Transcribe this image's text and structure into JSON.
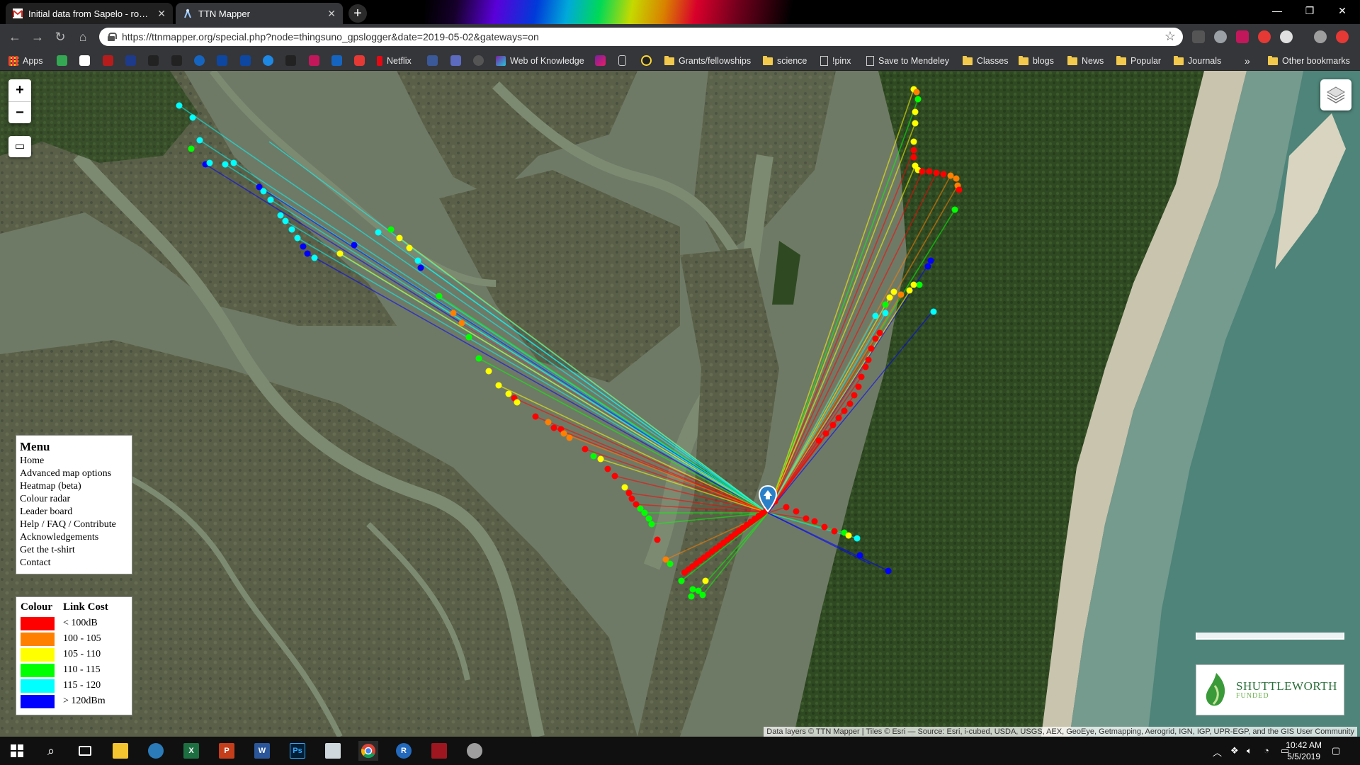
{
  "browser": {
    "tabs": [
      {
        "title": "Initial data from Sapelo - robert",
        "active": false
      },
      {
        "title": "TTN Mapper",
        "active": true
      }
    ],
    "url": "https://ttnmapper.org/special.php?node=thingsuno_gpslogger&date=2019-05-02&gateways=on",
    "bookmarks": [
      "Apps",
      "Netflix",
      "Web of Knowledge",
      "Grants/fellowships",
      "science",
      "!pinx",
      "Save to Mendeley",
      "Classes",
      "blogs",
      "News",
      "Popular",
      "Journals"
    ],
    "other_bookmarks": "Other bookmarks",
    "overflow": "»"
  },
  "map": {
    "zoom_in": "+",
    "zoom_out": "−",
    "menu": {
      "title": "Menu",
      "items": [
        "Home",
        "Advanced map options",
        "Heatmap (beta)",
        "Colour radar",
        "Leader board",
        "Help / FAQ / Contribute",
        "Acknowledgements",
        "Get the t-shirt",
        "Contact"
      ]
    },
    "legend": {
      "col_colour": "Colour",
      "col_cost": "Link Cost",
      "rows": [
        {
          "color": "#ff0000",
          "label": "< 100dB"
        },
        {
          "color": "#ff8000",
          "label": "100 - 105"
        },
        {
          "color": "#ffff00",
          "label": "105 - 110"
        },
        {
          "color": "#00ff00",
          "label": "110 - 115"
        },
        {
          "color": "#00ffff",
          "label": "115 - 120"
        },
        {
          "color": "#0000ff",
          "label": "> 120dBm"
        }
      ]
    },
    "sponsor": {
      "name": "SHUTTLEWORTH",
      "sub": "FUNDED"
    },
    "attribution": "Data layers © TTN Mapper | Tiles © Esri — Source: Esri, i-cubed, USDA, USGS, AEX, GeoEye, Getmapping, Aerogrid, IGN, IGP, UPR-EGP, and the GIS User Community"
  },
  "taskbar": {
    "time": "10:42 AM",
    "date": "5/5/2019"
  }
}
